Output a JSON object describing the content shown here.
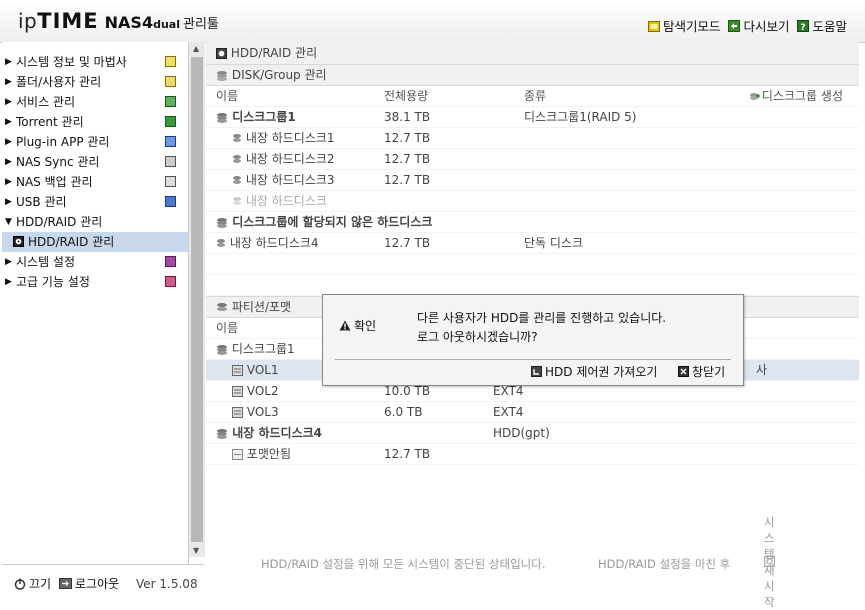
{
  "header": {
    "logo": {
      "brand_ip": "ip",
      "brand_time": "TIME",
      "model": "NAS4",
      "model_sub": "dual",
      "suffix": "관리툴"
    },
    "links": [
      {
        "label": "탐색기모드",
        "icon": "folder-icon"
      },
      {
        "label": "다시보기",
        "icon": "refresh-icon"
      },
      {
        "label": "도움말",
        "icon": "help-icon"
      }
    ]
  },
  "sidebar": {
    "items": [
      {
        "label": "시스템 정보 및 마법사",
        "expanded": false,
        "icon": "chart-icon",
        "icon_color": "#c8a000"
      },
      {
        "label": "폴더/사용자 관리",
        "expanded": false,
        "icon": "folder-user-icon",
        "icon_color": "#c8a000"
      },
      {
        "label": "서비스 관리",
        "expanded": false,
        "icon": "service-icon",
        "icon_color": "#2a8a2a"
      },
      {
        "label": "Torrent 관리",
        "expanded": false,
        "icon": "torrent-icon",
        "icon_color": "#2a8a2a"
      },
      {
        "label": "Plug-in APP 관리",
        "expanded": false,
        "icon": "plugin-icon",
        "icon_color": "#2a5ab0"
      },
      {
        "label": "NAS Sync 관리",
        "expanded": false,
        "icon": "sync-icon",
        "icon_color": "#666666"
      },
      {
        "label": "NAS 백업 관리",
        "expanded": false,
        "icon": "backup-icon",
        "icon_color": "#666666"
      },
      {
        "label": "USB 관리",
        "expanded": false,
        "icon": "usb-icon",
        "icon_color": "#2a5ab0"
      },
      {
        "label": "HDD/RAID 관리",
        "expanded": true,
        "icon": "",
        "icon_color": ""
      },
      {
        "label": "HDD/RAID 관리",
        "child": true,
        "selected": true,
        "icon": "hdd-icon",
        "icon_color": "#222222"
      },
      {
        "label": "시스템 설정",
        "expanded": false,
        "icon": "settings-icon",
        "icon_color": "#8a2a8a"
      },
      {
        "label": "고급 기능 설정",
        "expanded": false,
        "icon": "advanced-icon",
        "icon_color": "#b02a5a"
      }
    ]
  },
  "bottom": {
    "power_label": "끄기",
    "logout_label": "로그아웃",
    "version": "Ver 1.5.08"
  },
  "main": {
    "section_title": "HDD/RAID 관리",
    "disk_group": {
      "title": "DISK/Group 관리",
      "columns": [
        "이름",
        "전체용량",
        "종류"
      ],
      "create_label": "디스크그룹 생성",
      "rows": [
        {
          "name": "디스크그룹1",
          "capacity": "38.1 TB",
          "type": "디스크그룹1(RAID 5)",
          "level": 0,
          "bold": true,
          "icon": "disk-stack-icon"
        },
        {
          "name": "내장 하드디스크1",
          "capacity": "12.7 TB",
          "type": "",
          "level": 1,
          "icon": "disk-icon"
        },
        {
          "name": "내장 하드디스크2",
          "capacity": "12.7 TB",
          "type": "",
          "level": 1,
          "icon": "disk-icon"
        },
        {
          "name": "내장 하드디스크3",
          "capacity": "12.7 TB",
          "type": "",
          "level": 1,
          "icon": "disk-icon"
        },
        {
          "name": "내장 하드디스크",
          "capacity": "",
          "type": "",
          "level": 1,
          "disabled": true,
          "icon": "disk-icon"
        },
        {
          "name": "디스크그룹에 할당되지 않은 하드디스크",
          "capacity": "",
          "type": "",
          "level": 0,
          "bold": true,
          "icon": "disk-stack-icon"
        },
        {
          "name": "내장 하드디스크4",
          "capacity": "12.7 TB",
          "type": "단독 디스크",
          "level": 0,
          "icon": "disk-icon"
        }
      ]
    },
    "partition": {
      "title": "파티션/포맷",
      "columns": [
        "이름"
      ],
      "rows": [
        {
          "name": "디스크그룹1",
          "capacity": "",
          "type": "",
          "level": 0,
          "icon": "disk-stack-icon"
        },
        {
          "name": "VOL1",
          "capacity": "",
          "type": "사",
          "level": 1,
          "selected": true,
          "icon": "volume-icon"
        },
        {
          "name": "VOL2",
          "capacity": "10.0 TB",
          "type": "EXT4",
          "level": 1,
          "obscured": true,
          "icon": "volume-icon"
        },
        {
          "name": "VOL3",
          "capacity": "6.0 TB",
          "type": "EXT4",
          "level": 1,
          "icon": "volume-icon"
        },
        {
          "name": "내장 하드디스크4",
          "capacity": "",
          "type": "HDD(gpt)",
          "level": 0,
          "bold": true,
          "icon": "disk-stack-icon"
        },
        {
          "name": "포맷안됨",
          "capacity": "12.7 TB",
          "type": "",
          "level": 1,
          "icon": "volume-icon"
        }
      ]
    }
  },
  "footer": {
    "msg_left": "HDD/RAID 설정을 위해 모든 시스템이 중단된 상태입니다.",
    "msg_right": "HDD/RAID 설정을 마친 후",
    "restart_label": "시스템 재시작"
  },
  "dialog": {
    "title": "확인",
    "line1": "다른 사용자가 HDD를 관리를 진행하고 있습니다.",
    "line2": "로그 아웃하시겠습니까?",
    "take_control_label": "HDD 제어권 가져오기",
    "close_label": "창닫기"
  }
}
